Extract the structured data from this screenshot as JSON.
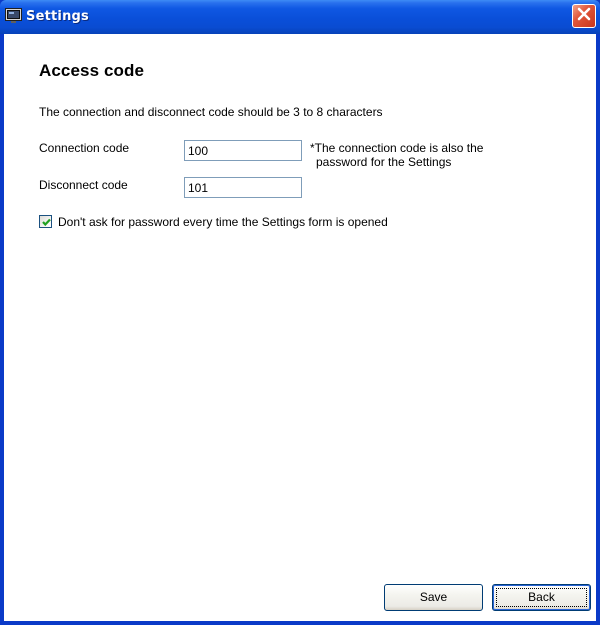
{
  "window": {
    "title": "Settings",
    "icon": "monitor-icon",
    "close_icon": "close-icon"
  },
  "page": {
    "heading": "Access code",
    "description": "The connection and disconnect code should be 3 to 8 characters"
  },
  "form": {
    "connection_label": "Connection code",
    "connection_value": "100",
    "disconnect_label": "Disconnect code",
    "disconnect_value": "101",
    "note_line1": "*The connection code is also the",
    "note_line2": "password for the Settings",
    "dont_ask_label": "Don't ask for password every time the Settings form is opened",
    "dont_ask_checked": true
  },
  "buttons": {
    "save_label": "Save",
    "back_label": "Back"
  },
  "colors": {
    "titlebar_blue": "#0a4fd9",
    "close_red": "#e0563a",
    "frame_blue": "#0a3ac8"
  }
}
